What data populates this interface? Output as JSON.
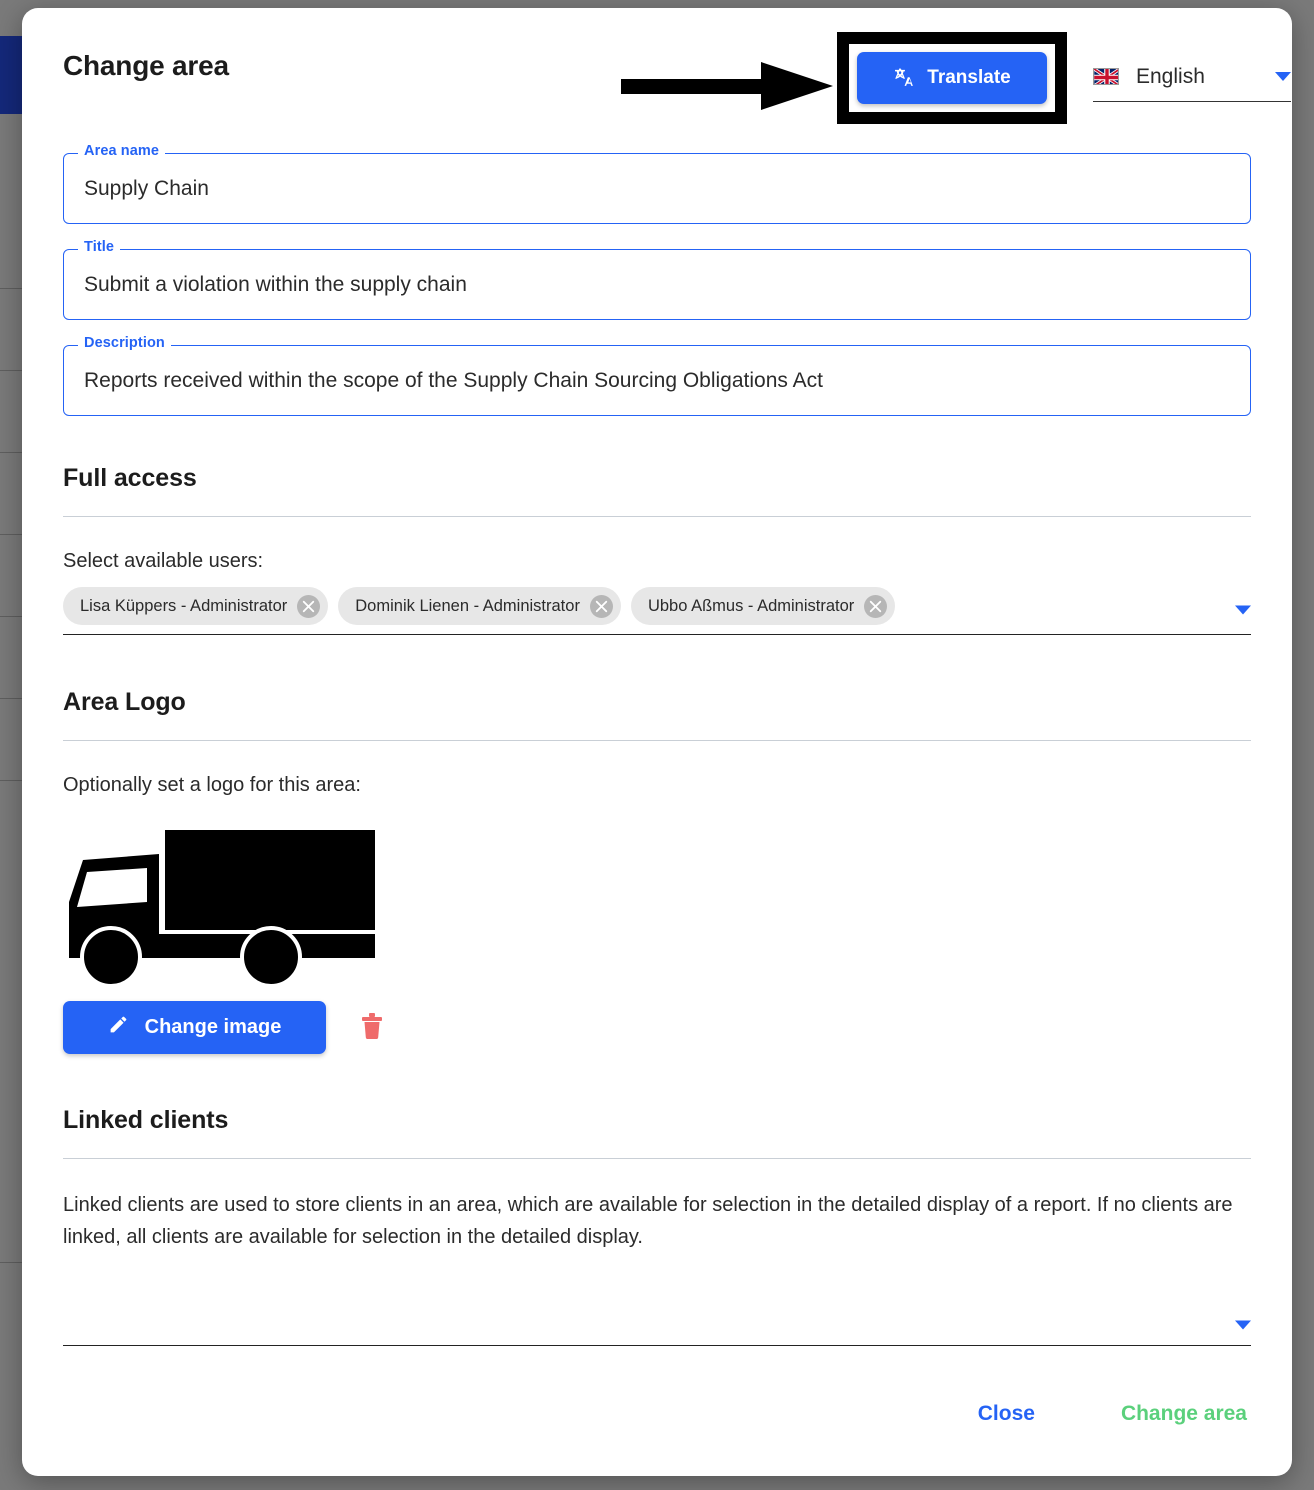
{
  "dialog": {
    "title": "Change area",
    "translate_button": {
      "label": "Translate",
      "icon": "translate-icon",
      "color": "#2563f5"
    },
    "language_select": {
      "value": "English",
      "flag": "uk-flag-icon",
      "caret": "chevron-down-icon"
    },
    "annotation": {
      "arrow": "right-arrow-annotation",
      "highlight": "translate-button-highlight"
    }
  },
  "fields": {
    "area_name": {
      "label": "Area name",
      "value": "Supply Chain"
    },
    "title": {
      "label": "Title",
      "value": "Submit a violation within the supply chain"
    },
    "description": {
      "label": "Description",
      "value": "Reports received within the scope of the Supply Chain Sourcing Obligations Act"
    }
  },
  "full_access": {
    "heading": "Full access",
    "prompt": "Select available users:",
    "chips": [
      {
        "label": "Lisa Küppers - Administrator",
        "remove_icon": "close-circle-icon"
      },
      {
        "label": "Dominik Lienen - Administrator",
        "remove_icon": "close-circle-icon"
      },
      {
        "label": "Ubbo Aßmus - Administrator",
        "remove_icon": "close-circle-icon"
      }
    ],
    "caret": "chevron-down-icon"
  },
  "area_logo": {
    "heading": "Area Logo",
    "prompt": "Optionally set a logo for this area:",
    "logo_alt": "delivery-truck-logo",
    "change_image_button": {
      "label": "Change image",
      "icon": "pencil-icon",
      "color": "#2563f5"
    },
    "delete_button": {
      "icon": "trash-icon",
      "color": "#ef6b6b"
    }
  },
  "linked_clients": {
    "heading": "Linked clients",
    "description": "Linked clients are used to store clients in an area, which are available for selection in the detailed display of a report. If no clients are linked, all clients are available for selection in the detailed display.",
    "select_value": "",
    "caret": "chevron-down-icon"
  },
  "footer": {
    "close_label": "Close",
    "close_color": "#2563f5",
    "submit_label": "Change area",
    "submit_color": "#5bd07c"
  },
  "background": {
    "overlay_color": "#7a7a7a",
    "navbar_color": "#14287a"
  }
}
